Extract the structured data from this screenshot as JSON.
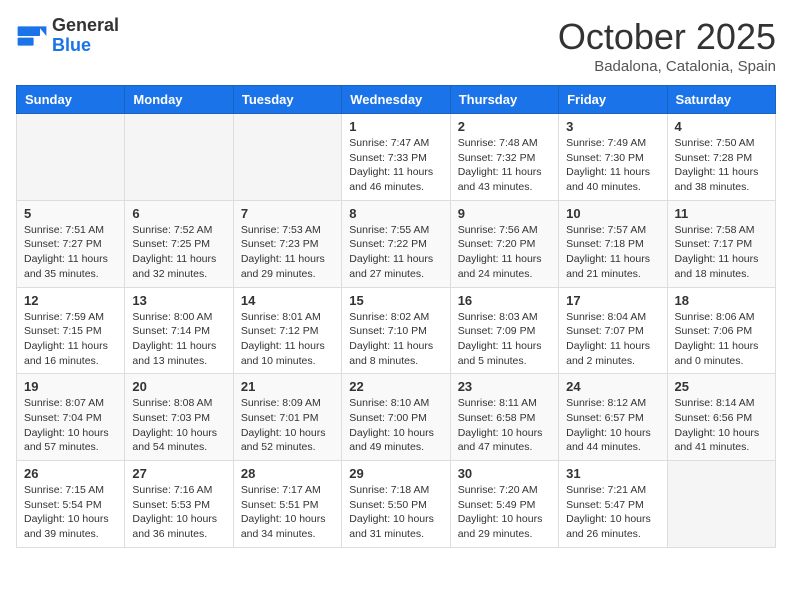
{
  "header": {
    "logo_general": "General",
    "logo_blue": "Blue",
    "month_title": "October 2025",
    "location": "Badalona, Catalonia, Spain"
  },
  "days_of_week": [
    "Sunday",
    "Monday",
    "Tuesday",
    "Wednesday",
    "Thursday",
    "Friday",
    "Saturday"
  ],
  "weeks": [
    [
      {
        "day": "",
        "info": ""
      },
      {
        "day": "",
        "info": ""
      },
      {
        "day": "",
        "info": ""
      },
      {
        "day": "1",
        "info": "Sunrise: 7:47 AM\nSunset: 7:33 PM\nDaylight: 11 hours and 46 minutes."
      },
      {
        "day": "2",
        "info": "Sunrise: 7:48 AM\nSunset: 7:32 PM\nDaylight: 11 hours and 43 minutes."
      },
      {
        "day": "3",
        "info": "Sunrise: 7:49 AM\nSunset: 7:30 PM\nDaylight: 11 hours and 40 minutes."
      },
      {
        "day": "4",
        "info": "Sunrise: 7:50 AM\nSunset: 7:28 PM\nDaylight: 11 hours and 38 minutes."
      }
    ],
    [
      {
        "day": "5",
        "info": "Sunrise: 7:51 AM\nSunset: 7:27 PM\nDaylight: 11 hours and 35 minutes."
      },
      {
        "day": "6",
        "info": "Sunrise: 7:52 AM\nSunset: 7:25 PM\nDaylight: 11 hours and 32 minutes."
      },
      {
        "day": "7",
        "info": "Sunrise: 7:53 AM\nSunset: 7:23 PM\nDaylight: 11 hours and 29 minutes."
      },
      {
        "day": "8",
        "info": "Sunrise: 7:55 AM\nSunset: 7:22 PM\nDaylight: 11 hours and 27 minutes."
      },
      {
        "day": "9",
        "info": "Sunrise: 7:56 AM\nSunset: 7:20 PM\nDaylight: 11 hours and 24 minutes."
      },
      {
        "day": "10",
        "info": "Sunrise: 7:57 AM\nSunset: 7:18 PM\nDaylight: 11 hours and 21 minutes."
      },
      {
        "day": "11",
        "info": "Sunrise: 7:58 AM\nSunset: 7:17 PM\nDaylight: 11 hours and 18 minutes."
      }
    ],
    [
      {
        "day": "12",
        "info": "Sunrise: 7:59 AM\nSunset: 7:15 PM\nDaylight: 11 hours and 16 minutes."
      },
      {
        "day": "13",
        "info": "Sunrise: 8:00 AM\nSunset: 7:14 PM\nDaylight: 11 hours and 13 minutes."
      },
      {
        "day": "14",
        "info": "Sunrise: 8:01 AM\nSunset: 7:12 PM\nDaylight: 11 hours and 10 minutes."
      },
      {
        "day": "15",
        "info": "Sunrise: 8:02 AM\nSunset: 7:10 PM\nDaylight: 11 hours and 8 minutes."
      },
      {
        "day": "16",
        "info": "Sunrise: 8:03 AM\nSunset: 7:09 PM\nDaylight: 11 hours and 5 minutes."
      },
      {
        "day": "17",
        "info": "Sunrise: 8:04 AM\nSunset: 7:07 PM\nDaylight: 11 hours and 2 minutes."
      },
      {
        "day": "18",
        "info": "Sunrise: 8:06 AM\nSunset: 7:06 PM\nDaylight: 11 hours and 0 minutes."
      }
    ],
    [
      {
        "day": "19",
        "info": "Sunrise: 8:07 AM\nSunset: 7:04 PM\nDaylight: 10 hours and 57 minutes."
      },
      {
        "day": "20",
        "info": "Sunrise: 8:08 AM\nSunset: 7:03 PM\nDaylight: 10 hours and 54 minutes."
      },
      {
        "day": "21",
        "info": "Sunrise: 8:09 AM\nSunset: 7:01 PM\nDaylight: 10 hours and 52 minutes."
      },
      {
        "day": "22",
        "info": "Sunrise: 8:10 AM\nSunset: 7:00 PM\nDaylight: 10 hours and 49 minutes."
      },
      {
        "day": "23",
        "info": "Sunrise: 8:11 AM\nSunset: 6:58 PM\nDaylight: 10 hours and 47 minutes."
      },
      {
        "day": "24",
        "info": "Sunrise: 8:12 AM\nSunset: 6:57 PM\nDaylight: 10 hours and 44 minutes."
      },
      {
        "day": "25",
        "info": "Sunrise: 8:14 AM\nSunset: 6:56 PM\nDaylight: 10 hours and 41 minutes."
      }
    ],
    [
      {
        "day": "26",
        "info": "Sunrise: 7:15 AM\nSunset: 5:54 PM\nDaylight: 10 hours and 39 minutes."
      },
      {
        "day": "27",
        "info": "Sunrise: 7:16 AM\nSunset: 5:53 PM\nDaylight: 10 hours and 36 minutes."
      },
      {
        "day": "28",
        "info": "Sunrise: 7:17 AM\nSunset: 5:51 PM\nDaylight: 10 hours and 34 minutes."
      },
      {
        "day": "29",
        "info": "Sunrise: 7:18 AM\nSunset: 5:50 PM\nDaylight: 10 hours and 31 minutes."
      },
      {
        "day": "30",
        "info": "Sunrise: 7:20 AM\nSunset: 5:49 PM\nDaylight: 10 hours and 29 minutes."
      },
      {
        "day": "31",
        "info": "Sunrise: 7:21 AM\nSunset: 5:47 PM\nDaylight: 10 hours and 26 minutes."
      },
      {
        "day": "",
        "info": ""
      }
    ]
  ]
}
